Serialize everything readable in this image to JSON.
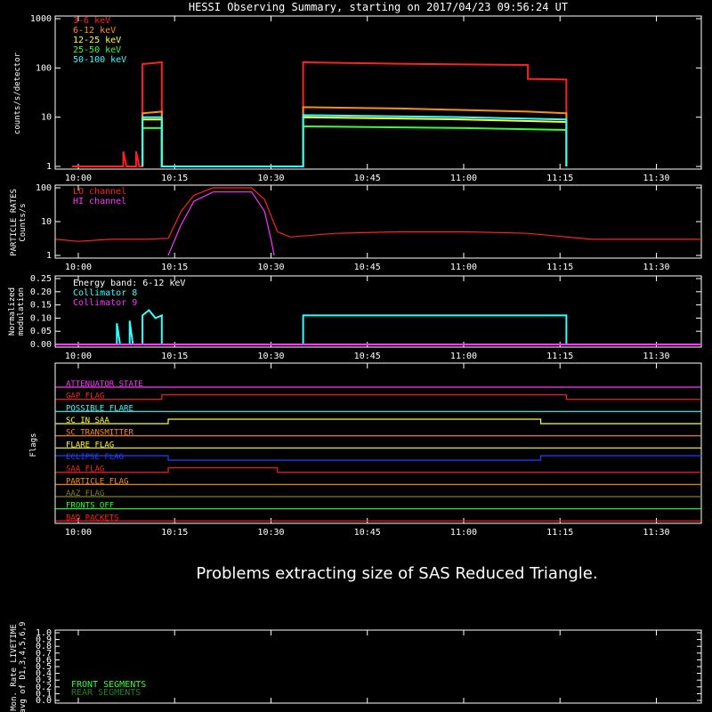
{
  "title": "HESSI Observing Summary, starting on 2017/04/23 09:56:24 UT",
  "message": "Problems extracting size of SAS Reduced Triangle.",
  "time_ticks": [
    "10:00",
    "10:15",
    "10:30",
    "10:45",
    "11:00",
    "11:15",
    "11:30"
  ],
  "colors": {
    "axis": "#ffffff",
    "red": "#ff2020",
    "orange": "#ff8c1a",
    "yellow": "#ffff33",
    "green": "#33ff33",
    "cyan": "#33ffff",
    "magenta": "#ff33ff"
  },
  "chart_data": [
    {
      "type": "line",
      "name": "countrates",
      "ylabel": "counts/s/detector",
      "yscale": "log",
      "ylim": [
        1,
        1000
      ],
      "ytick_labels": [
        "1",
        "10",
        "100",
        "1000"
      ],
      "series": [
        {
          "name": "3-6 keV",
          "color": "#ff2020",
          "points": [
            [
              "09:59:00",
              1
            ],
            [
              "10:07:00",
              1
            ],
            [
              "10:07:00",
              2
            ],
            [
              "10:07:30",
              1
            ],
            [
              "10:09:00",
              1
            ],
            [
              "10:09:00",
              2
            ],
            [
              "10:09:30",
              1
            ],
            [
              "10:10:00",
              1
            ],
            [
              "10:10:00",
              120
            ],
            [
              "10:13:00",
              130
            ],
            [
              "10:13:00",
              1
            ],
            [
              "10:35:00",
              1
            ],
            [
              "10:35:00",
              130
            ],
            [
              "10:50:00",
              122
            ],
            [
              "11:00:00",
              118
            ],
            [
              "11:10:00",
              115
            ],
            [
              "11:10:00",
              60
            ],
            [
              "11:16:00",
              58
            ],
            [
              "11:16:00",
              1
            ]
          ]
        },
        {
          "name": "6-12 keV",
          "color": "#ff8c1a",
          "points": [
            [
              "10:10:00",
              1
            ],
            [
              "10:10:00",
              12
            ],
            [
              "10:13:00",
              13
            ],
            [
              "10:13:00",
              1
            ],
            [
              "10:35:00",
              1
            ],
            [
              "10:35:00",
              16
            ],
            [
              "10:50:00",
              15
            ],
            [
              "11:00:00",
              14
            ],
            [
              "11:10:00",
              13
            ],
            [
              "11:16:00",
              12
            ],
            [
              "11:16:00",
              1
            ]
          ]
        },
        {
          "name": "12-25 keV",
          "color": "#ffff33",
          "points": [
            [
              "10:10:00",
              1
            ],
            [
              "10:10:00",
              9
            ],
            [
              "10:13:00",
              9
            ],
            [
              "10:13:00",
              1
            ],
            [
              "10:35:00",
              1
            ],
            [
              "10:35:00",
              10
            ],
            [
              "11:00:00",
              9
            ],
            [
              "11:16:00",
              8
            ],
            [
              "11:16:00",
              1
            ]
          ]
        },
        {
          "name": "25-50 keV",
          "color": "#33ff33",
          "points": [
            [
              "10:10:00",
              1
            ],
            [
              "10:10:00",
              6
            ],
            [
              "10:13:00",
              6
            ],
            [
              "10:13:00",
              1
            ],
            [
              "10:35:00",
              1
            ],
            [
              "10:35:00",
              6.5
            ],
            [
              "11:00:00",
              6
            ],
            [
              "11:16:00",
              5.5
            ],
            [
              "11:16:00",
              1
            ]
          ]
        },
        {
          "name": "50-100 keV",
          "color": "#33ffff",
          "points": [
            [
              "10:10:00",
              1
            ],
            [
              "10:10:00",
              10
            ],
            [
              "10:13:00",
              10
            ],
            [
              "10:13:00",
              1
            ],
            [
              "10:35:00",
              1
            ],
            [
              "10:35:00",
              11
            ],
            [
              "11:00:00",
              10
            ],
            [
              "11:16:00",
              9
            ],
            [
              "11:16:00",
              1
            ]
          ]
        }
      ]
    },
    {
      "type": "line",
      "name": "particle-rates",
      "ylabel": "PARTICLE RATES",
      "ylabel2": "Counts/s",
      "yscale": "log",
      "ylim": [
        1,
        100
      ],
      "ytick_labels": [
        "1",
        "10",
        "100"
      ],
      "series": [
        {
          "name": "LO channel",
          "color": "#ff2020",
          "points": [
            [
              "09:56:30",
              3
            ],
            [
              "10:00:00",
              2.6
            ],
            [
              "10:05:00",
              3
            ],
            [
              "10:10:00",
              3
            ],
            [
              "10:14:00",
              3.2
            ],
            [
              "10:16:00",
              20
            ],
            [
              "10:18:00",
              60
            ],
            [
              "10:21:00",
              100
            ],
            [
              "10:27:00",
              100
            ],
            [
              "10:29:00",
              45
            ],
            [
              "10:31:00",
              5
            ],
            [
              "10:33:00",
              3.5
            ],
            [
              "10:40:00",
              4.5
            ],
            [
              "10:50:00",
              5
            ],
            [
              "11:00:00",
              5
            ],
            [
              "11:10:00",
              4.5
            ],
            [
              "11:20:00",
              3
            ],
            [
              "11:37:00",
              3
            ]
          ]
        },
        {
          "name": "HI channel",
          "color": "#ff33ff",
          "points": [
            [
              "10:14:00",
              1
            ],
            [
              "10:16:00",
              8
            ],
            [
              "10:18:00",
              40
            ],
            [
              "10:21:00",
              75
            ],
            [
              "10:27:00",
              75
            ],
            [
              "10:29:00",
              20
            ],
            [
              "10:30:00",
              3
            ],
            [
              "10:30:30",
              1
            ]
          ]
        }
      ]
    },
    {
      "type": "line",
      "name": "modulation",
      "ylabel": "Normalized",
      "ylabel2": "modulation",
      "ylim": [
        0,
        0.25
      ],
      "ytick_labels": [
        "0.00",
        "0.05",
        "0.10",
        "0.15",
        "0.20",
        "0.25"
      ],
      "annotation": "Energy band: 6-12 keV",
      "series": [
        {
          "name": "Collimator 8",
          "color": "#33ffff",
          "points": [
            [
              "10:06:00",
              0
            ],
            [
              "10:06:00",
              0.08
            ],
            [
              "10:06:30",
              0
            ],
            [
              "10:08:00",
              0
            ],
            [
              "10:08:00",
              0.09
            ],
            [
              "10:08:30",
              0
            ],
            [
              "10:10:00",
              0
            ],
            [
              "10:10:00",
              0.11
            ],
            [
              "10:11:00",
              0.13
            ],
            [
              "10:12:00",
              0.1
            ],
            [
              "10:13:00",
              0.11
            ],
            [
              "10:13:00",
              0
            ],
            [
              "10:35:00",
              0
            ],
            [
              "10:35:00",
              0.11
            ],
            [
              "10:50:00",
              0.11
            ],
            [
              "11:00:00",
              0.11
            ],
            [
              "11:16:00",
              0.11
            ],
            [
              "11:16:00",
              0
            ]
          ]
        },
        {
          "name": "Collimator 9",
          "color": "#ff33ff",
          "points": [
            [
              "09:56:30",
              0
            ],
            [
              "11:37:00",
              0
            ]
          ]
        }
      ]
    },
    {
      "type": "line",
      "name": "flags",
      "ylabel": "Flags",
      "series": [
        {
          "name": "ATTENUATOR STATE",
          "color": "#ff33ff",
          "points": [
            [
              "09:56:30",
              0
            ],
            [
              "11:37:00",
              0
            ]
          ]
        },
        {
          "name": "GAP FLAG",
          "color": "#ff2020",
          "points": [
            [
              "09:56:30",
              0
            ],
            [
              "10:13:00",
              0
            ],
            [
              "10:13:00",
              1
            ],
            [
              "11:16:00",
              1
            ],
            [
              "11:16:00",
              0
            ],
            [
              "11:37:00",
              0
            ]
          ]
        },
        {
          "name": "POSSIBLE FLARE",
          "color": "#33ffff",
          "points": [
            [
              "09:56:30",
              0
            ],
            [
              "11:37:00",
              0
            ]
          ]
        },
        {
          "name": "SC IN SAA",
          "color": "#ffff33",
          "points": [
            [
              "09:56:30",
              0
            ],
            [
              "10:14:00",
              0
            ],
            [
              "10:14:00",
              1
            ],
            [
              "11:12:00",
              1
            ],
            [
              "11:12:00",
              0
            ],
            [
              "11:37:00",
              0
            ]
          ]
        },
        {
          "name": "SC TRANSMITTER",
          "color": "#ff8c1a",
          "points": [
            [
              "09:56:30",
              0
            ],
            [
              "11:37:00",
              0
            ]
          ]
        },
        {
          "name": "FLARE FLAG",
          "color": "#ffff33",
          "points": [
            [
              "09:56:30",
              0
            ],
            [
              "11:37:00",
              0
            ]
          ]
        },
        {
          "name": "ECLIPSE FLAG",
          "color": "#2040ff",
          "points": [
            [
              "09:56:30",
              1
            ],
            [
              "10:14:00",
              1
            ],
            [
              "10:14:00",
              0
            ],
            [
              "11:12:00",
              0
            ],
            [
              "11:12:00",
              1
            ],
            [
              "11:37:00",
              1
            ]
          ]
        },
        {
          "name": "SAA FLAG",
          "color": "#ff2020",
          "points": [
            [
              "09:56:30",
              0
            ],
            [
              "10:14:00",
              0
            ],
            [
              "10:14:00",
              1
            ],
            [
              "10:31:00",
              1
            ],
            [
              "10:31:00",
              0
            ],
            [
              "11:37:00",
              0
            ]
          ]
        },
        {
          "name": "PARTICLE FLAG",
          "color": "#ff8c1a",
          "points": [
            [
              "09:56:30",
              0
            ],
            [
              "11:37:00",
              0
            ]
          ]
        },
        {
          "name": "AAZ FLAG",
          "color": "#808020",
          "points": [
            [
              "09:56:30",
              0
            ],
            [
              "11:37:00",
              0
            ]
          ]
        },
        {
          "name": "FRONTS OFF",
          "color": "#33ff33",
          "points": [
            [
              "09:56:30",
              0
            ],
            [
              "11:37:00",
              0
            ]
          ]
        },
        {
          "name": "BAD PACKETS",
          "color": "#ff2020",
          "points": [
            [
              "09:56:30",
              0
            ],
            [
              "11:37:00",
              0
            ]
          ]
        }
      ]
    },
    {
      "type": "line",
      "name": "livetime",
      "ylabel": "Mon. Rate LIVETIME",
      "ylabel2": "avg of D1,3,4,5,6,9",
      "ylim": [
        0,
        1.0
      ],
      "ytick_labels": [
        "0.0",
        "0.1",
        "0.2",
        "0.3",
        "0.4",
        "0.5",
        "0.6",
        "0.7",
        "0.8",
        "0.9",
        "1.0"
      ],
      "legend": [
        {
          "name": "FRONT SEGMENTS",
          "color": "#33ff33"
        },
        {
          "name": "REAR SEGMENTS",
          "color": "#208020"
        }
      ]
    }
  ]
}
